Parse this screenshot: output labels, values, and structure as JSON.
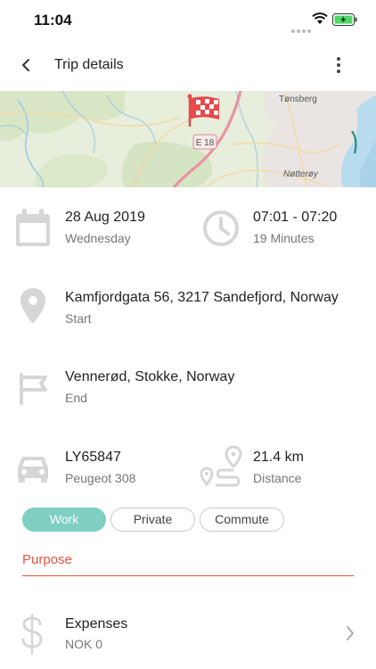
{
  "status": {
    "time": "11:04"
  },
  "nav": {
    "title": "Trip details"
  },
  "map": {
    "road_label": "E 18",
    "labels": [
      "Tønsberg",
      "Nøtterøy"
    ]
  },
  "date": {
    "value": "28 Aug 2019",
    "weekday": "Wednesday"
  },
  "time": {
    "range": "07:01 - 07:20",
    "duration": "19 Minutes"
  },
  "start": {
    "address": "Kamfjordgata 56, 3217 Sandefjord, Norway",
    "label": "Start"
  },
  "end": {
    "address": "Vennerød, Stokke, Norway",
    "label": "End"
  },
  "vehicle": {
    "plate": "LY65847",
    "model": "Peugeot 308"
  },
  "distance": {
    "value": "21.4 km",
    "label": "Distance"
  },
  "categories": [
    {
      "label": "Work",
      "selected": true
    },
    {
      "label": "Private",
      "selected": false
    },
    {
      "label": "Commute",
      "selected": false
    }
  ],
  "purpose": {
    "placeholder": "Purpose"
  },
  "expenses": {
    "title": "Expenses",
    "value": "NOK 0"
  },
  "colors": {
    "accent": "#7fcfc3",
    "purpose": "#e8533f",
    "icon": "#d6d6d6",
    "flag": "#e64a4a"
  }
}
